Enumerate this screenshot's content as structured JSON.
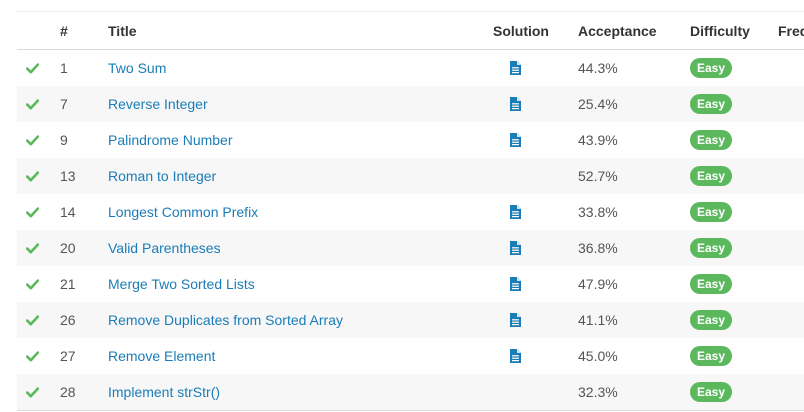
{
  "table": {
    "headers": {
      "number": "#",
      "title": "Title",
      "solution": "Solution",
      "acceptance": "Acceptance",
      "difficulty": "Difficulty",
      "frequency": "Freq"
    },
    "rows": [
      {
        "solved": true,
        "number": "1",
        "title": "Two Sum",
        "has_solution": true,
        "acceptance": "44.3%",
        "difficulty": "Easy"
      },
      {
        "solved": true,
        "number": "7",
        "title": "Reverse Integer",
        "has_solution": true,
        "acceptance": "25.4%",
        "difficulty": "Easy"
      },
      {
        "solved": true,
        "number": "9",
        "title": "Palindrome Number",
        "has_solution": true,
        "acceptance": "43.9%",
        "difficulty": "Easy"
      },
      {
        "solved": true,
        "number": "13",
        "title": "Roman to Integer",
        "has_solution": false,
        "acceptance": "52.7%",
        "difficulty": "Easy"
      },
      {
        "solved": true,
        "number": "14",
        "title": "Longest Common Prefix",
        "has_solution": true,
        "acceptance": "33.8%",
        "difficulty": "Easy"
      },
      {
        "solved": true,
        "number": "20",
        "title": "Valid Parentheses",
        "has_solution": true,
        "acceptance": "36.8%",
        "difficulty": "Easy"
      },
      {
        "solved": true,
        "number": "21",
        "title": "Merge Two Sorted Lists",
        "has_solution": true,
        "acceptance": "47.9%",
        "difficulty": "Easy"
      },
      {
        "solved": true,
        "number": "26",
        "title": "Remove Duplicates from Sorted Array",
        "has_solution": true,
        "acceptance": "41.1%",
        "difficulty": "Easy"
      },
      {
        "solved": true,
        "number": "27",
        "title": "Remove Element",
        "has_solution": true,
        "acceptance": "45.0%",
        "difficulty": "Easy"
      },
      {
        "solved": true,
        "number": "28",
        "title": "Implement strStr()",
        "has_solution": false,
        "acceptance": "32.3%",
        "difficulty": "Easy"
      }
    ]
  },
  "icons": {
    "solved": "check-icon",
    "solution": "document-icon"
  },
  "colors": {
    "link": "#1a7db8",
    "check": "#5cb85c",
    "easy_badge": "#5cb85c",
    "solution_icon": "#1a7db8",
    "alt_row": "#f7f7f7"
  }
}
